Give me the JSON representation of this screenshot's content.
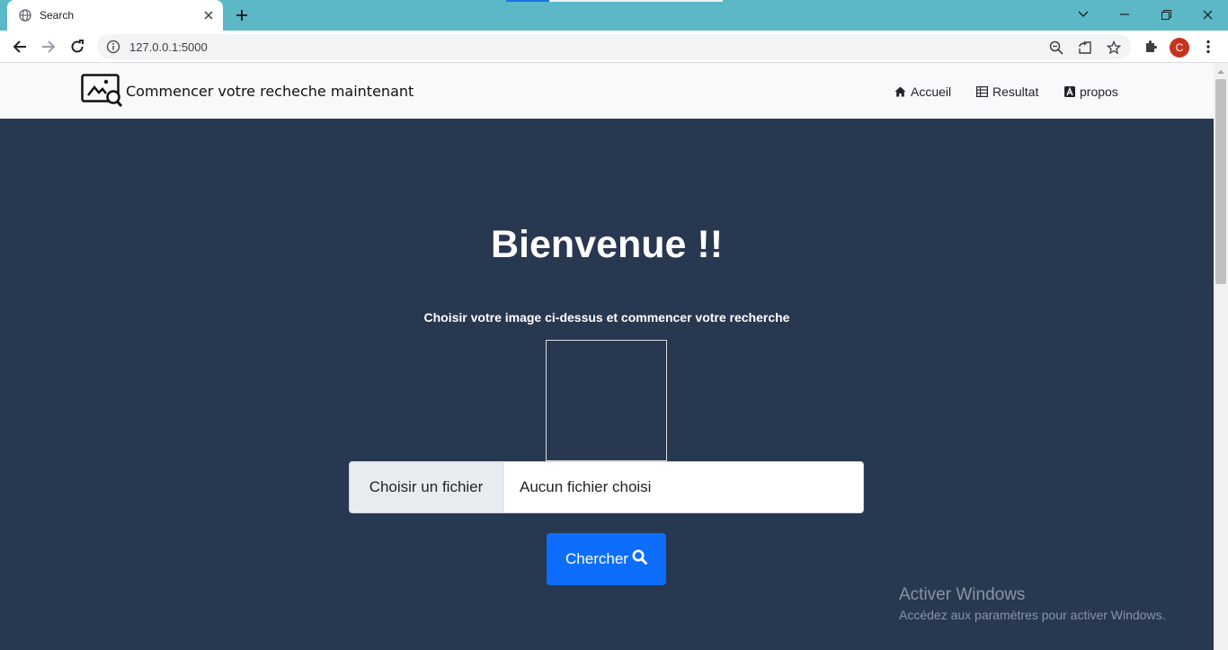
{
  "browser": {
    "tab_title": "Search",
    "url": "127.0.0.1:5000",
    "profile_initial": "C",
    "icons": [
      "globe-icon",
      "close-icon",
      "plus-icon",
      "chevron-down-icon",
      "minimize-icon",
      "restore-icon",
      "back-arrow-icon",
      "forward-arrow-icon",
      "reload-icon",
      "info-icon",
      "zoom-icon",
      "share-icon",
      "star-icon",
      "puzzle-icon",
      "kebab-menu-icon"
    ]
  },
  "navbar": {
    "brand_text": "Commencer votre recheche maintenant",
    "links": [
      {
        "label": "Accueil",
        "icon": "home-icon"
      },
      {
        "label": "Resultat",
        "icon": "table-icon"
      },
      {
        "label": "propos",
        "icon": "font-icon"
      }
    ]
  },
  "hero": {
    "title": "Bienvenue !!",
    "subtitle": "Choisir votre image ci-dessus et commencer votre recherche"
  },
  "upload": {
    "choose_label": "Choisir un fichier",
    "no_file_label": "Aucun fichier choisi"
  },
  "search_button": {
    "label": "Chercher",
    "icon": "search-icon"
  },
  "watermark": {
    "title": "Activer Windows",
    "subtitle": "Accédez aux paramètres pour activer Windows."
  },
  "colors": {
    "tabstrip": "#5cb8c6",
    "page_bg": "#283850",
    "primary": "#0d6efd",
    "navbar_bg": "#f8f9fa"
  }
}
